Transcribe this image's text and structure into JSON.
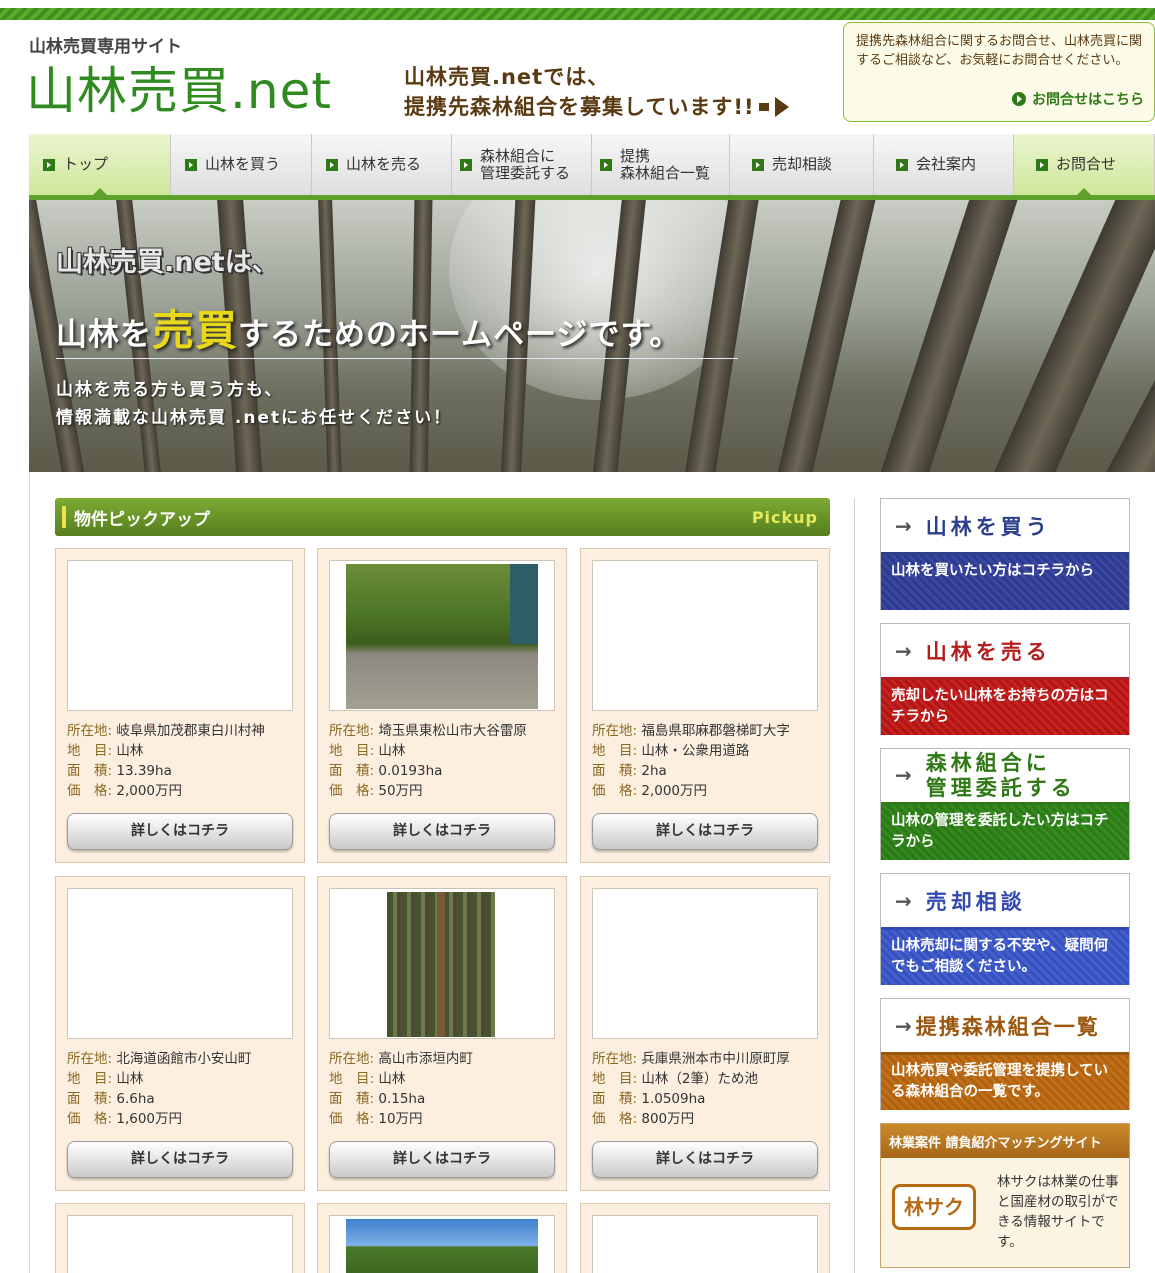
{
  "header": {
    "site_subtitle": "山林売買専用サイト",
    "logo": "山林売買.net",
    "recruit_line1": "山林売買.netでは、",
    "recruit_line2": "提携先森林組合を募集しています!!",
    "contact_text": "提携先森林組合に関するお問合せ、山林売買に関するご相談など、お気軽にお問合せください。",
    "contact_link": "お問合せはこちら"
  },
  "nav": {
    "items": [
      {
        "label": "トップ",
        "active": true
      },
      {
        "label": "山林を買う"
      },
      {
        "label": "山林を売る"
      },
      {
        "label": "森林組合に\n管理委託する"
      },
      {
        "label": "提携\n森林組合一覧"
      },
      {
        "label": "売却相談"
      },
      {
        "label": "会社案内"
      },
      {
        "label": "お問合せ"
      }
    ]
  },
  "hero": {
    "line1": "山林売買.netは、",
    "line2_pre": "山林を",
    "line2_hl1": "売",
    "line2_hl2": "買",
    "line2_post": "するためのホームページです。",
    "line3a": "山林を売る方も買う方も、",
    "line3b": "情報満載な山林売買 .netにお任せください！"
  },
  "pickup": {
    "title": "物件ピックアップ",
    "title_en": "Pickup",
    "labels": {
      "location": "所在地:",
      "category": "地　目:",
      "area": "面　積:",
      "price": "価　格:"
    },
    "button": "詳しくはコチラ",
    "items": [
      {
        "location": "岐阜県加茂郡東白川村神",
        "category": "山林",
        "area": "13.39ha",
        "price": "2,000万円",
        "photo": "none"
      },
      {
        "location": "埼玉県東松山市大谷雷原",
        "category": "山林",
        "area": "0.0193ha",
        "price": "50万円",
        "photo": "road"
      },
      {
        "location": "福島県耶麻郡磐梯町大字",
        "category": "山林・公衆用道路",
        "area": "2ha",
        "price": "2,000万円",
        "photo": "none"
      },
      {
        "location": "北海道函館市小安山町",
        "category": "山林",
        "area": "6.6ha",
        "price": "1,600万円",
        "photo": "none"
      },
      {
        "location": "高山市添垣内町",
        "category": "山林",
        "area": "0.15ha",
        "price": "10万円",
        "photo": "forest"
      },
      {
        "location": "兵庫県洲本市中川原町厚",
        "category": "山林（2筆）ため池",
        "area": "1.0509ha",
        "price": "800万円",
        "photo": "none"
      }
    ]
  },
  "sidebar": {
    "buy": {
      "title": "山林を買う",
      "desc": "山林を買いたい方はコチラから"
    },
    "sell": {
      "title": "山林を売る",
      "desc": "売却したい山林をお持ちの方はコチラから"
    },
    "manage": {
      "title1": "森林組合に",
      "title2": "管理委託する",
      "desc": "山林の管理を委託したい方はコチラから"
    },
    "consult": {
      "title": "売却相談",
      "desc": "山林売却に関する不安や、疑問何でもご相談ください。"
    },
    "list": {
      "title": "提携森林組合一覧",
      "desc": "山林売買や委託管理を提携している森林組合の一覧です。"
    },
    "rinsaku": {
      "head": "林業案件 請負紹介マッチングサイト",
      "logo": "林サク",
      "desc": "林サクは林業の仕事と国産材の取引ができる情報サイトです。"
    }
  },
  "colors": {
    "brand_green": "#2f8a1f",
    "nav_green": "#5da12b",
    "buy": "#2e3a8c",
    "sell": "#b31515",
    "manage": "#2b7a18",
    "consult": "#3650c0",
    "list": "#b0620e"
  }
}
